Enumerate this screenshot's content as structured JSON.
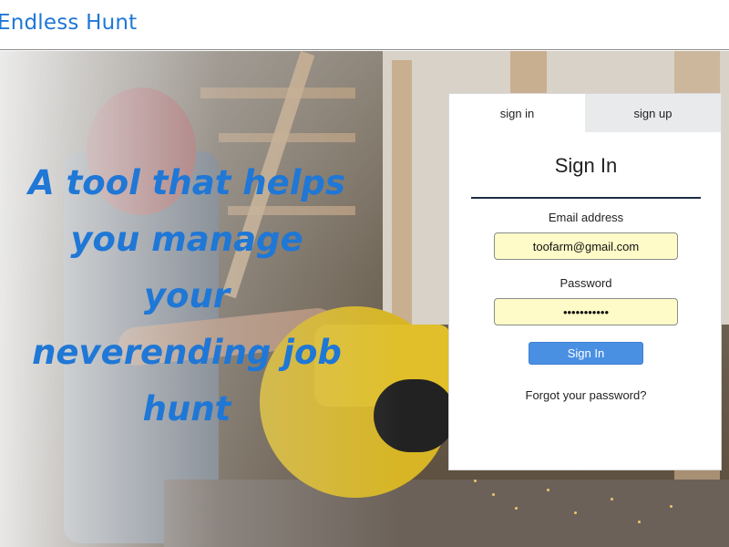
{
  "navbar": {
    "brand": "Endless Hunt"
  },
  "hero": {
    "tagline": "A tool that helps you manage your neverending job hunt"
  },
  "auth": {
    "tabs": [
      {
        "label": "sign in",
        "active": true
      },
      {
        "label": "sign up",
        "active": false
      }
    ],
    "title": "Sign In",
    "email": {
      "label": "Email address",
      "value": "toofarm@gmail.com"
    },
    "password": {
      "label": "Password",
      "value": "•••••••••••"
    },
    "submit_label": "Sign In",
    "forgot_label": "Forgot your password?"
  },
  "colors": {
    "brand": "#1f77d6",
    "button": "#4a90e2",
    "input_fill": "#fefbc8",
    "inactive_tab": "#e9eaec"
  }
}
